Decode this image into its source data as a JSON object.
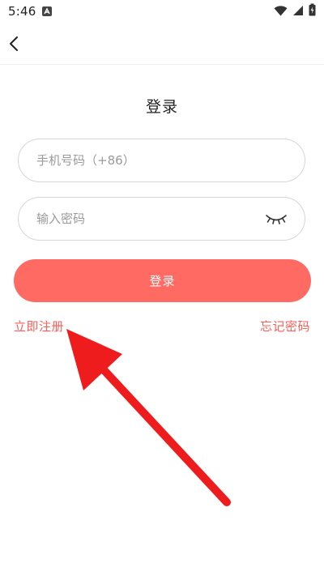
{
  "status_bar": {
    "time": "5:46",
    "app_icon": "A"
  },
  "icons": {
    "back": "chevron-left",
    "wifi": "wifi",
    "signal": "cellular-signal",
    "battery": "battery-charging",
    "eye": "eye-closed"
  },
  "login": {
    "title": "登录",
    "phone_placeholder": "手机号码（+86）",
    "password_placeholder": "输入密码",
    "submit_label": "登录",
    "register_label": "立即注册",
    "forgot_label": "忘记密码"
  },
  "colors": {
    "accent": "#ff6b63",
    "link": "#ff5d55",
    "annotation": "#ee1c1c"
  }
}
